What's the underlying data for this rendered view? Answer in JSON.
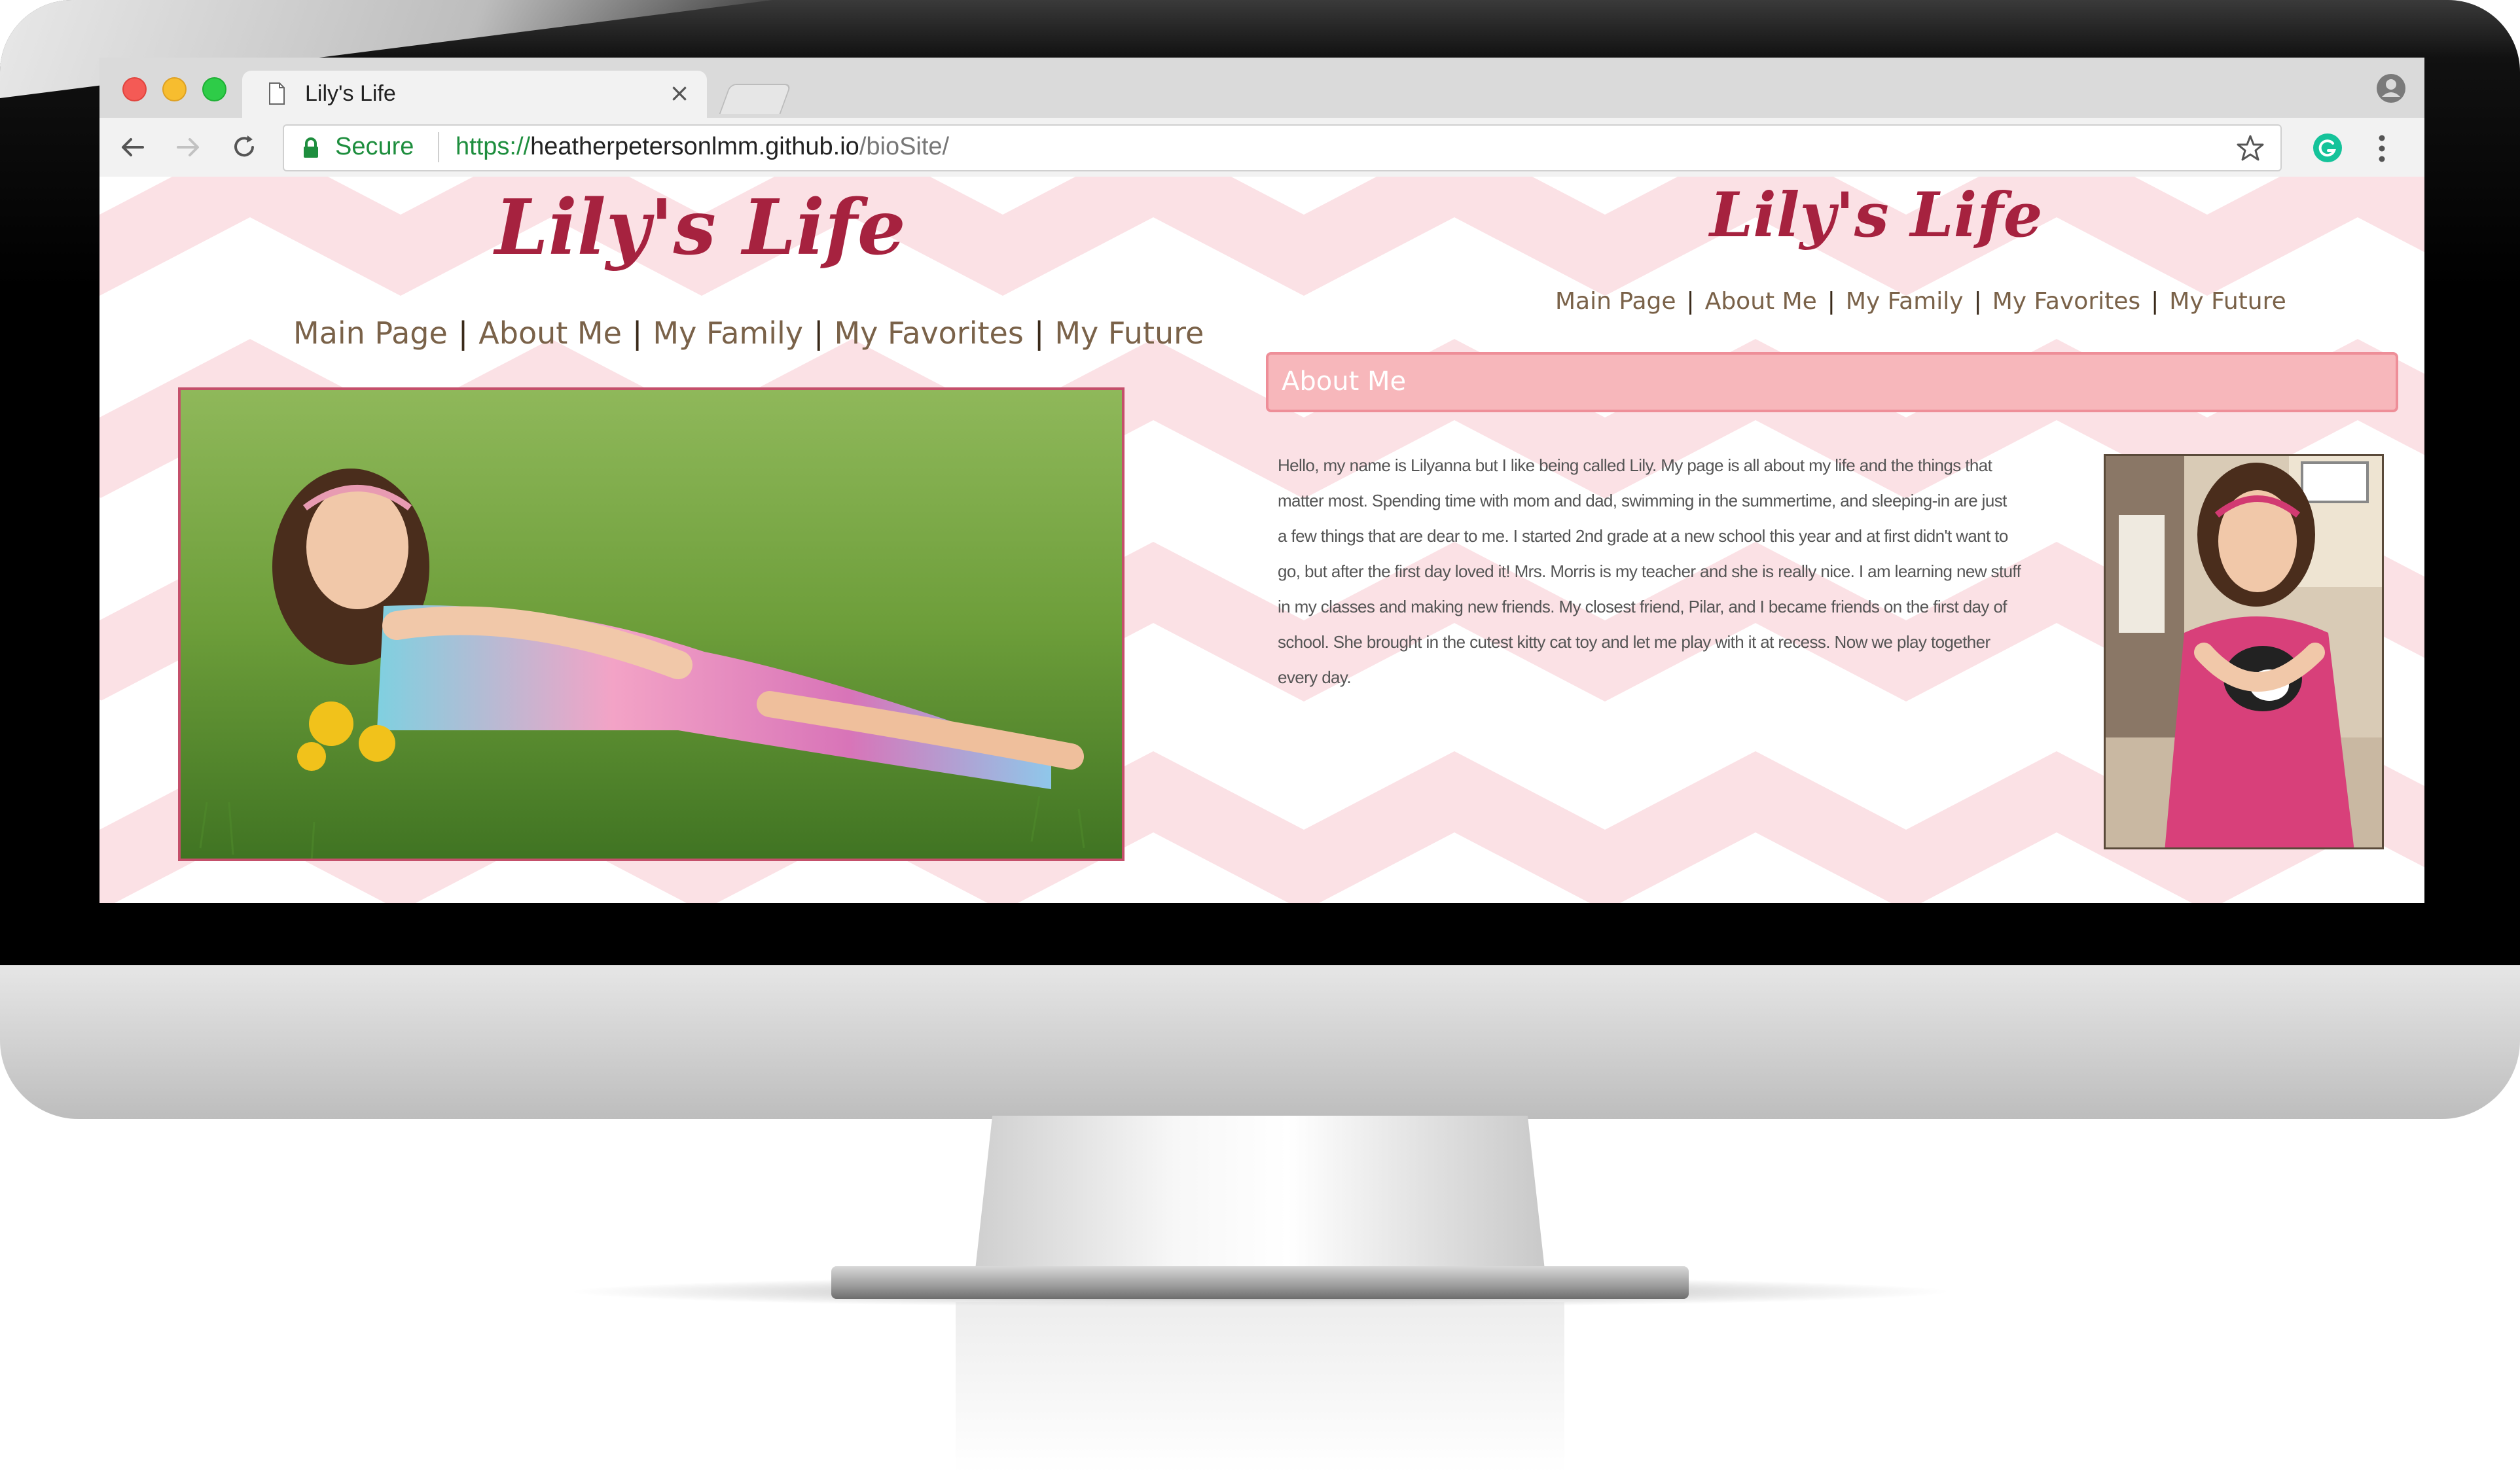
{
  "browser": {
    "tab_title": "Lily's Life",
    "tab_close": "×",
    "secure_label": "Secure",
    "url": {
      "scheme": "https://",
      "host": "heatherpetersonlmm.github.io",
      "path": "/bioSite/"
    }
  },
  "left_panel": {
    "site_title": "Lily's Life",
    "nav": [
      "Main Page",
      "About Me",
      "My Family",
      "My Favorites",
      "My Future"
    ],
    "nav_separator": "|"
  },
  "right_panel": {
    "site_title": "Lily's Life",
    "nav": [
      "Main Page",
      "About Me",
      "My Family",
      "My Favorites",
      "My Future"
    ],
    "nav_separator": "|",
    "section_heading": "About Me",
    "bio_lines": [
      "Hello, my name is Lilyanna but I like being called Lily. My page is all about my life and the things that",
      "matter most. Spending time with mom and dad, swimming in the summertime, and sleeping-in are just",
      "a few things that are dear to me. I started 2nd grade at a new school this year and at first didn't want to",
      "go, but after the first day loved it! Mrs. Morris is my teacher and she is really nice. I am learning new stuff",
      "in my classes and making new friends. My closest friend, Pilar, and I became friends on the first day of",
      "school. She brought in the cutest kitty cat toy and let me play with it at recess. Now we play together",
      "every day."
    ]
  },
  "colors": {
    "brand_title": "#a6223f",
    "nav_text": "#7a6249",
    "chevron_pink": "#fbe1e5",
    "section_bar_fill": "#f7b7bb",
    "section_bar_border": "#ee8e98",
    "secure_green": "#1e8e3e"
  },
  "icons": [
    "page-icon",
    "close-icon",
    "profile-icon",
    "back-arrow-icon",
    "forward-arrow-icon",
    "reload-icon",
    "lock-icon",
    "star-icon",
    "grammarly-icon",
    "more-vert-icon"
  ]
}
